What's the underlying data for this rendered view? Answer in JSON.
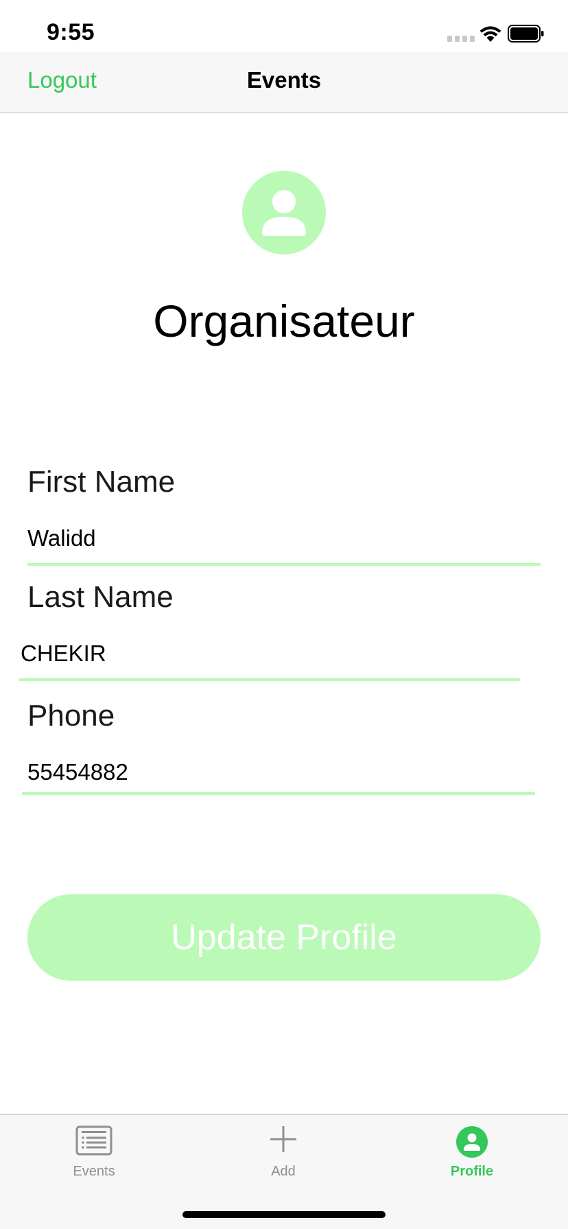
{
  "status_bar": {
    "time": "9:55"
  },
  "nav": {
    "logout_label": "Logout",
    "title": "Events"
  },
  "profile": {
    "avatar_icon": "person-circle-icon",
    "role": "Organisateur"
  },
  "form": {
    "first_name": {
      "label": "First Name",
      "value": "Walidd"
    },
    "last_name": {
      "label": "Last Name",
      "value": "CHEKIR"
    },
    "phone": {
      "label": "Phone",
      "value": "55454882"
    }
  },
  "actions": {
    "update_label": "Update Profile"
  },
  "tab_bar": {
    "items": [
      {
        "label": "Events",
        "icon": "list-icon",
        "active": false
      },
      {
        "label": "Add",
        "icon": "plus-icon",
        "active": false
      },
      {
        "label": "Profile",
        "icon": "person-circle-icon",
        "active": true
      }
    ]
  },
  "colors": {
    "accent": "#34c759",
    "light_accent": "#bafab6",
    "inactive_tab": "#8e8e93",
    "bar_background": "#f7f7f7"
  }
}
